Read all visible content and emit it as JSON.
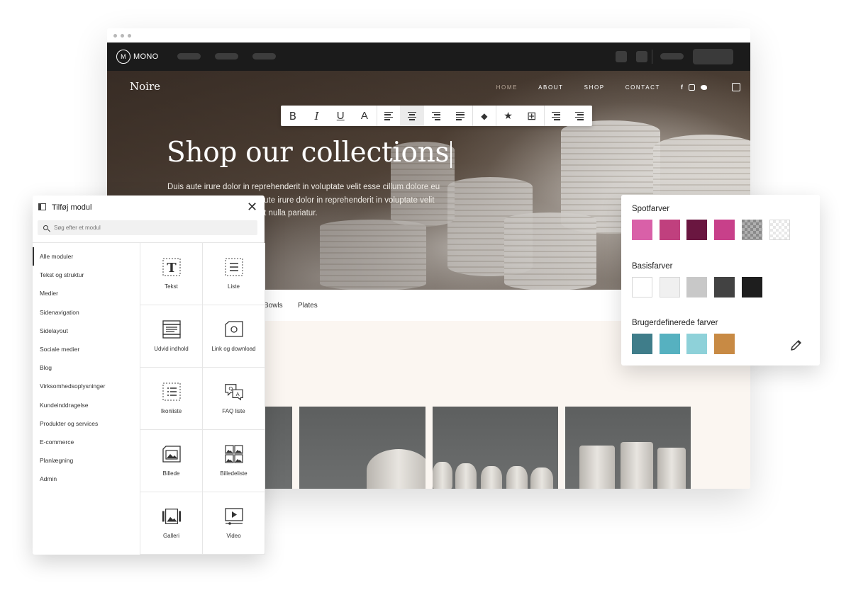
{
  "editor": {
    "logo_text": "MONO",
    "logo_mark": "M"
  },
  "site": {
    "brand": "Noire",
    "nav": [
      "HOME",
      "ABOUT",
      "SHOP",
      "CONTACT"
    ],
    "social": [
      "f",
      "◎",
      "🐦"
    ],
    "hero_title": "Shop our collections",
    "hero_text": "Duis aute irure dolor in reprehenderit in voluptate velit esse cillum dolore eu fugiat nulla pariatur. Duis aute irure dolor in reprehenderit in voluptate velit esse cillum dolore eu fugiat nulla pariatur.",
    "filters": [
      "Bowls",
      "Plates"
    ]
  },
  "toolbar": {
    "buttons": [
      "bold",
      "italic",
      "underline",
      "text-color",
      "align-left",
      "align-center",
      "align-right",
      "justify",
      "clear-format",
      "star",
      "table",
      "bullet-list",
      "numbered-list"
    ],
    "bold_glyph": "B",
    "italic_glyph": "I",
    "underline_glyph": "U",
    "color_glyph": "A",
    "star_glyph": "★",
    "table_glyph": "⊞",
    "eraser_glyph": "◆"
  },
  "module_panel": {
    "title": "Tilføj modul",
    "close_glyph": "✕",
    "search_placeholder": "Søg efter et modul",
    "categories": [
      "Alle moduler",
      "Tekst og struktur",
      "Medier",
      "Sidenavigation",
      "Sidelayout",
      "Sociale medier",
      "Blog",
      "Virksomhedsoplysninger",
      "Kundeinddragelse",
      "Produkter og services",
      "E-commerce",
      "Planlægning",
      "Admin"
    ],
    "active_category": "Alle moduler",
    "tiles": [
      {
        "label": "Tekst",
        "icon": "text-icon"
      },
      {
        "label": "Liste",
        "icon": "list-icon"
      },
      {
        "label": "Udvid indhold",
        "icon": "expand-content-icon"
      },
      {
        "label": "Link og download",
        "icon": "link-download-icon"
      },
      {
        "label": "Ikonliste",
        "icon": "icon-list-icon"
      },
      {
        "label": "FAQ liste",
        "icon": "faq-icon"
      },
      {
        "label": "Billede",
        "icon": "image-icon"
      },
      {
        "label": "Billedeliste",
        "icon": "image-list-icon"
      },
      {
        "label": "Galleri",
        "icon": "gallery-icon"
      },
      {
        "label": "Video",
        "icon": "video-icon"
      }
    ]
  },
  "color_panel": {
    "spot_title": "Spotfarver",
    "spot_colors": [
      "#d960a8",
      "#c0407e",
      "#6a1640",
      "#c8408a",
      "checker-dark",
      "checker-light"
    ],
    "base_title": "Basisfarver",
    "base_colors": [
      "#ffffff",
      "#f0f0f0",
      "#c8c8c8",
      "#424242",
      "#1e1e1e"
    ],
    "custom_title": "Brugerdefinerede farver",
    "custom_colors": [
      "#3f7d8a",
      "#56b1c0",
      "#8ed1d9",
      "#c88a44"
    ]
  }
}
